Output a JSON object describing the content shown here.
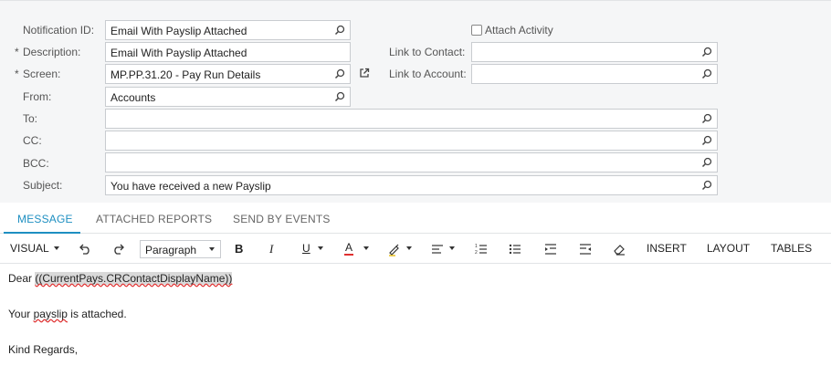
{
  "form": {
    "notification_id": {
      "label": "Notification ID:",
      "value": "Email With Payslip Attached"
    },
    "description": {
      "required_mark": "*",
      "label": "Description:",
      "value": "Email With Payslip Attached"
    },
    "screen": {
      "required_mark": "*",
      "label": "Screen:",
      "value": "MP.PP.31.20 - Pay Run Details"
    },
    "from": {
      "label": "From:",
      "value": "Accounts"
    },
    "to": {
      "label": "To:",
      "value": ""
    },
    "cc": {
      "label": "CC:",
      "value": ""
    },
    "bcc": {
      "label": "BCC:",
      "value": ""
    },
    "subject": {
      "label": "Subject:",
      "value": "You have received a new Payslip"
    },
    "attach_activity": {
      "label": "Attach Activity",
      "checked": false
    },
    "link_to_contact": {
      "label": "Link to Contact:",
      "value": ""
    },
    "link_to_account": {
      "label": "Link to Account:",
      "value": ""
    }
  },
  "tabs": [
    {
      "label": "MESSAGE",
      "active": true
    },
    {
      "label": "ATTACHED REPORTS",
      "active": false
    },
    {
      "label": "SEND BY EVENTS",
      "active": false
    }
  ],
  "toolbar": {
    "mode": "VISUAL",
    "paragraph": "Paragraph",
    "bold": "B",
    "italic": "I",
    "underline": "U",
    "font_color": "A",
    "insert": "INSERT",
    "layout": "LAYOUT",
    "tables": "TABLES",
    "icons": [
      "undo-icon",
      "redo-icon",
      "highlighter-icon",
      "align-icon",
      "ordered-list-icon",
      "bullet-list-icon",
      "indent-icon",
      "outdent-icon",
      "eraser-icon"
    ]
  },
  "editor": {
    "greeting": "Dear",
    "placeholder": "((CurrentPays.CRContactDisplayName))",
    "line2_a": "Your",
    "line2_b": "payslip",
    "line2_c": "is attached.",
    "line3": "Kind Regards,"
  },
  "colors": {
    "accent": "#1e8fc1",
    "font_color_bar": "#e03030"
  }
}
